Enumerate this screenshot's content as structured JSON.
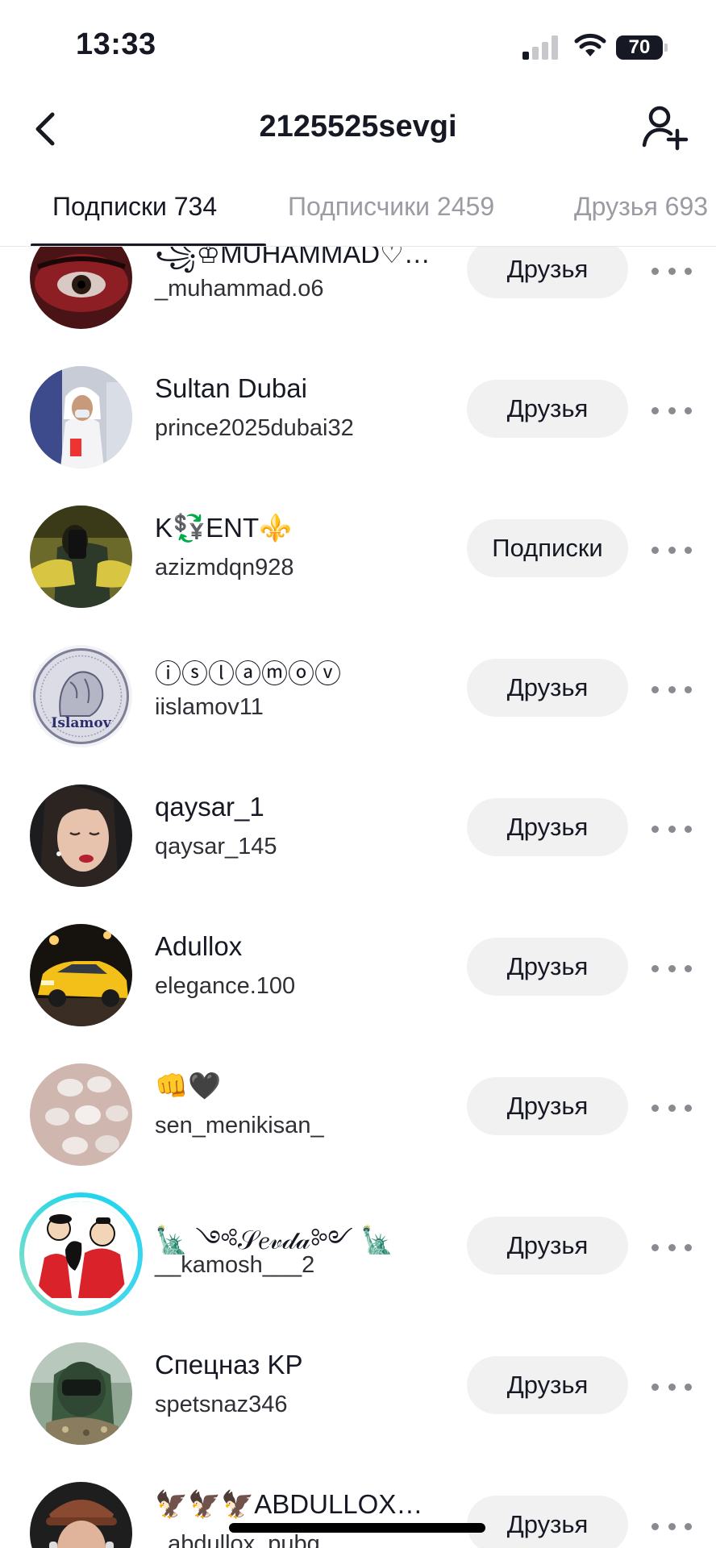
{
  "status_bar": {
    "time": "13:33",
    "battery": "70"
  },
  "header": {
    "title": "2125525sevgi"
  },
  "tabs": [
    {
      "label": "Подписки 734"
    },
    {
      "label": "Подписчики 2459"
    },
    {
      "label": "Друзья 693"
    }
  ],
  "users": [
    {
      "display_name": "꧁♔MUHAMMAD♡…",
      "username": "_muhammad.o6",
      "button": "Друзья"
    },
    {
      "display_name": "Sultan Dubai",
      "username": "prince2025dubai32",
      "button": "Друзья"
    },
    {
      "display_name": "K💱ENT⚜️",
      "username": "azizmdqn928",
      "button": "Подписки"
    },
    {
      "display_name": "ⓘⓢⓛⓐⓜⓞⓥ",
      "username": "iislamov11",
      "button": "Друзья",
      "avatar_text": "Islamov"
    },
    {
      "display_name": "qaysar_1",
      "username": "qaysar_145",
      "button": "Друзья"
    },
    {
      "display_name": "Adullox",
      "username": "elegance.100",
      "button": "Друзья"
    },
    {
      "display_name": "👊🖤",
      "username": "sen_menikisan_",
      "button": "Друзья"
    },
    {
      "display_name": "🗽 ༺𝒮𝑒𝓋𝒹𝒶༻ 🗽",
      "username": "__kamosh___2",
      "button": "Друзья"
    },
    {
      "display_name": "Спецназ KP",
      "username": "spetsnaz346",
      "button": "Друзья"
    },
    {
      "display_name": "🦅🦅🦅ABDULLOX…",
      "username": "_abdullox_pubg",
      "button": "Друзья"
    }
  ]
}
